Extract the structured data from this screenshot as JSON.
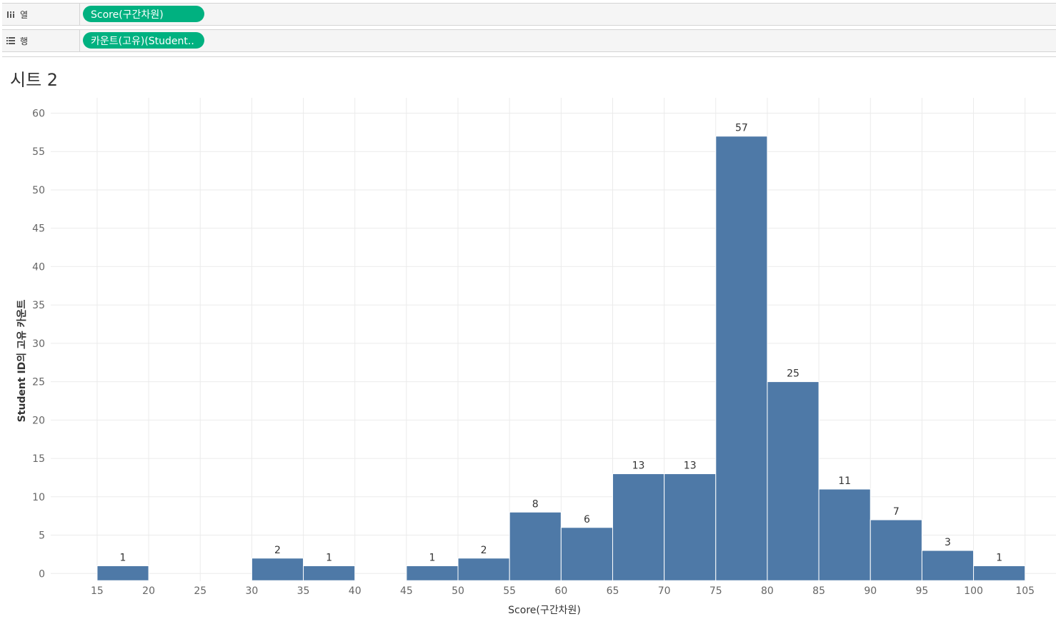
{
  "shelves": {
    "columns": {
      "label": "열",
      "pill": "Score(구간차원)"
    },
    "rows": {
      "label": "행",
      "pill": "카운트(고유)(Student.."
    }
  },
  "sheet": {
    "title": "시트 2"
  },
  "colors": {
    "bar": "#4e79a7",
    "pill": "#00b180",
    "grid": "#ebebeb"
  },
  "chart_data": {
    "type": "bar",
    "xlabel": "Score(구간차원)",
    "ylabel": "Student ID의 고유 카운트",
    "x_ticks": [
      15,
      20,
      25,
      30,
      35,
      40,
      45,
      50,
      55,
      60,
      65,
      70,
      75,
      80,
      85,
      90,
      95,
      100,
      105
    ],
    "y_ticks": [
      0,
      5,
      10,
      15,
      20,
      25,
      30,
      35,
      40,
      45,
      50,
      55,
      60
    ],
    "bin_width": 5,
    "bins": [
      {
        "start": 15,
        "value": 1
      },
      {
        "start": 30,
        "value": 2
      },
      {
        "start": 35,
        "value": 1
      },
      {
        "start": 45,
        "value": 1
      },
      {
        "start": 50,
        "value": 2
      },
      {
        "start": 55,
        "value": 8
      },
      {
        "start": 60,
        "value": 6
      },
      {
        "start": 65,
        "value": 13
      },
      {
        "start": 70,
        "value": 13
      },
      {
        "start": 75,
        "value": 57
      },
      {
        "start": 80,
        "value": 25
      },
      {
        "start": 85,
        "value": 11
      },
      {
        "start": 90,
        "value": 7
      },
      {
        "start": 95,
        "value": 3
      },
      {
        "start": 100,
        "value": 1
      }
    ],
    "xlim": [
      10.5,
      108
    ],
    "ylim": [
      -1,
      62
    ],
    "grid": true,
    "data_labels": true
  }
}
